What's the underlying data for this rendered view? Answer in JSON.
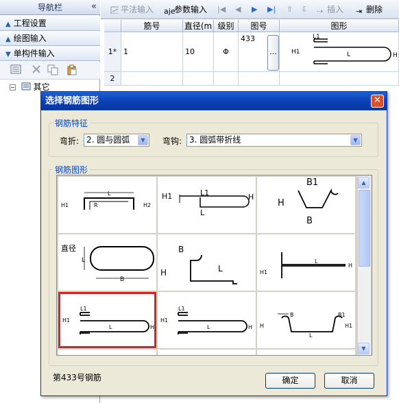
{
  "nav": {
    "title": "导航栏",
    "items": [
      {
        "label": "工程设置"
      },
      {
        "label": "绘图输入"
      },
      {
        "label": "单构件输入"
      }
    ],
    "tree_root": "其它"
  },
  "toolbar": {
    "flat_input": "平法输入",
    "param_input": "参数输入",
    "insert": "插入",
    "delete": "删除"
  },
  "grid": {
    "headers": [
      "筋号",
      "直径(m",
      "级别",
      "图号",
      "图形"
    ],
    "rows": [
      {
        "row_no": "1*",
        "bar_no": "1",
        "diameter": "10",
        "grade": "Φ",
        "figure_no": "433",
        "more": "...",
        "shape_labels": {
          "h1": "H1",
          "l1": "L1",
          "l": "L",
          "h": "H"
        }
      },
      {
        "row_no": "2",
        "bar_no": "",
        "diameter": "",
        "grade": "",
        "figure_no": "",
        "more": "",
        "shape_labels": {}
      }
    ]
  },
  "dialog": {
    "title": "选择钢筋图形",
    "close": "✕",
    "features_group": "钢筋特征",
    "bend_label": "弯折:",
    "bend_value": "2. 圆与圆弧",
    "hook_label": "弯钩:",
    "hook_value": "3. 圆弧带折线",
    "shapes_group": "钢筋图形",
    "status": "第433号钢筋",
    "ok": "确定",
    "cancel": "取消",
    "selected_index": 6,
    "selection_color": "#e02020"
  },
  "shapes": [
    {
      "id": "u-frame",
      "labels": {
        "h1": "H1",
        "l": "L",
        "r": "R",
        "h2": "H2"
      }
    },
    {
      "id": "hook-line",
      "labels": {
        "h1": "H1",
        "l1": "L1",
        "l": "L",
        "h": "H"
      }
    },
    {
      "id": "bowl",
      "labels": {
        "b1": "B1",
        "h": "H",
        "b": "B"
      }
    },
    {
      "id": "stadium",
      "labels": {
        "diameter": "直径",
        "l": "L",
        "b": "B"
      }
    },
    {
      "id": "l-hook",
      "labels": {
        "b": "B",
        "h": "H",
        "l": "L"
      }
    },
    {
      "id": "double-bar",
      "labels": {
        "h1": "H1",
        "l": "L",
        "h": "H"
      }
    },
    {
      "id": "shape-433",
      "labels": {
        "h1": "H1",
        "l1": "L1",
        "l": "L",
        "h": "H"
      }
    },
    {
      "id": "shape-433b",
      "labels": {
        "h1": "H1",
        "l1": "L1",
        "l": "L",
        "h": "H"
      }
    },
    {
      "id": "tray",
      "labels": {
        "b": "B",
        "b1": "B1",
        "h": "H",
        "l": "L",
        "h1": "H1"
      }
    }
  ]
}
